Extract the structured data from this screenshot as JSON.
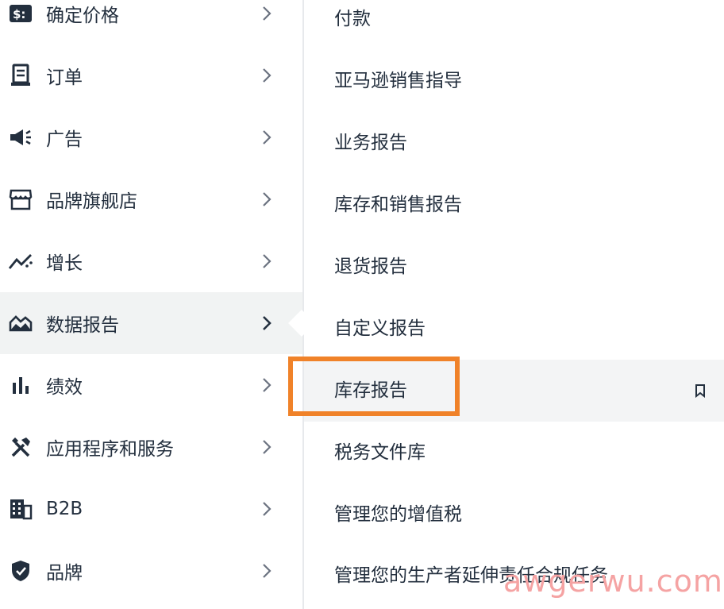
{
  "left_menu": [
    {
      "label": "确定价格",
      "icon": "pricing-icon"
    },
    {
      "label": "订单",
      "icon": "orders-icon"
    },
    {
      "label": "广告",
      "icon": "megaphone-icon"
    },
    {
      "label": "品牌旗舰店",
      "icon": "storefront-icon"
    },
    {
      "label": "增长",
      "icon": "growth-icon"
    },
    {
      "label": "数据报告",
      "icon": "reports-icon",
      "active": true
    },
    {
      "label": "绩效",
      "icon": "bar-chart-icon"
    },
    {
      "label": "应用程序和服务",
      "icon": "tools-icon"
    },
    {
      "label": "B2B",
      "icon": "building-icon"
    },
    {
      "label": "品牌",
      "icon": "shield-icon"
    }
  ],
  "submenu": [
    {
      "label": "付款"
    },
    {
      "label": "亚马逊销售指导"
    },
    {
      "label": "业务报告"
    },
    {
      "label": "库存和销售报告"
    },
    {
      "label": "退货报告"
    },
    {
      "label": "自定义报告"
    },
    {
      "label": "库存报告",
      "highlighted": true
    },
    {
      "label": "税务文件库"
    },
    {
      "label": "管理您的增值税"
    },
    {
      "label": "管理您的生产者延伸责任合规任务"
    }
  ],
  "watermark": "awgerwu.com",
  "colors": {
    "highlight_box": "#f08229",
    "text": "#232f3e",
    "active_bg": "#f1f3f3"
  }
}
